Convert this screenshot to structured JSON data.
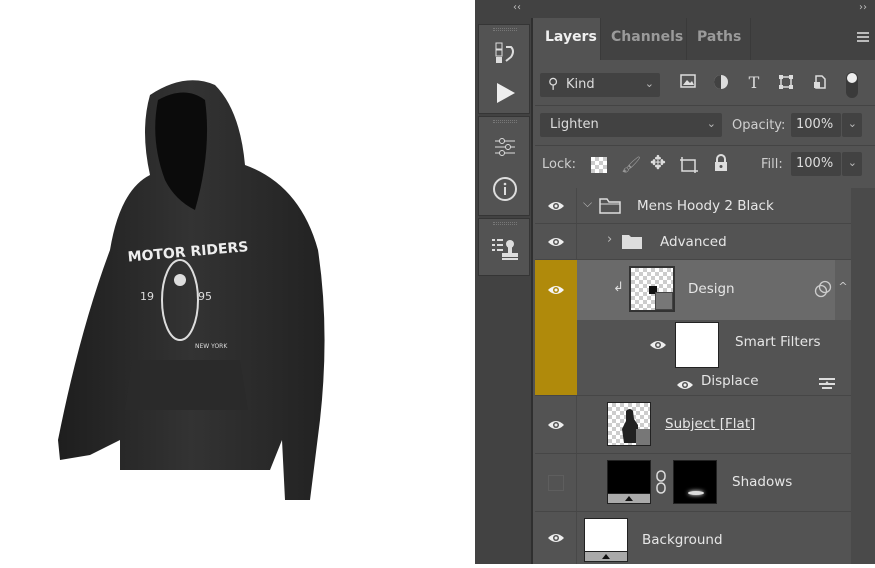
{
  "canvas": {
    "artwork": "Mens hoodie mockup with MOTOR RIDERS 1995 print",
    "print_text": "MOTOR RIDERS",
    "print_year_left": "19",
    "print_year_right": "95",
    "print_city": "NEW YORK"
  },
  "panel": {
    "collapse_left": "‹‹",
    "collapse_right": "››",
    "dock_icons": [
      "history-icon",
      "play-actions-icon",
      "adjustments-icon",
      "info-icon",
      "clone-source-icon"
    ],
    "tabs": [
      {
        "label": "Layers",
        "active": true
      },
      {
        "label": "Channels",
        "active": false
      },
      {
        "label": "Paths",
        "active": false
      }
    ],
    "filter": {
      "kind_label": "Kind",
      "icons": [
        "image-filter-icon",
        "adjustment-filter-icon",
        "type-filter-icon",
        "shape-filter-icon",
        "smart-object-filter-icon"
      ]
    },
    "blend_mode": "Lighten",
    "opacity_label": "Opacity:",
    "opacity_value": "100%",
    "lock_label": "Lock:",
    "fill_label": "Fill:",
    "fill_value": "100%",
    "highlight_color": "#b08a0b",
    "layers": [
      {
        "name": "Mens Hoody 2 Black",
        "type": "group",
        "expanded": true,
        "visible": true
      },
      {
        "name": "Advanced",
        "type": "group",
        "expanded": false,
        "visible": true
      },
      {
        "name": "Design",
        "type": "smart-object",
        "clipped": true,
        "selected": true,
        "visible": true
      },
      {
        "name": "Smart Filters",
        "type": "smart-filters",
        "visible": true
      },
      {
        "name": "Displace",
        "type": "filter",
        "visible": true
      },
      {
        "name": "Subject [Flat]",
        "type": "smart-object",
        "visible": true
      },
      {
        "name": "Shadows",
        "type": "adjustment-with-mask",
        "visible": false
      },
      {
        "name": "Background",
        "type": "fill",
        "visible": true
      }
    ]
  }
}
